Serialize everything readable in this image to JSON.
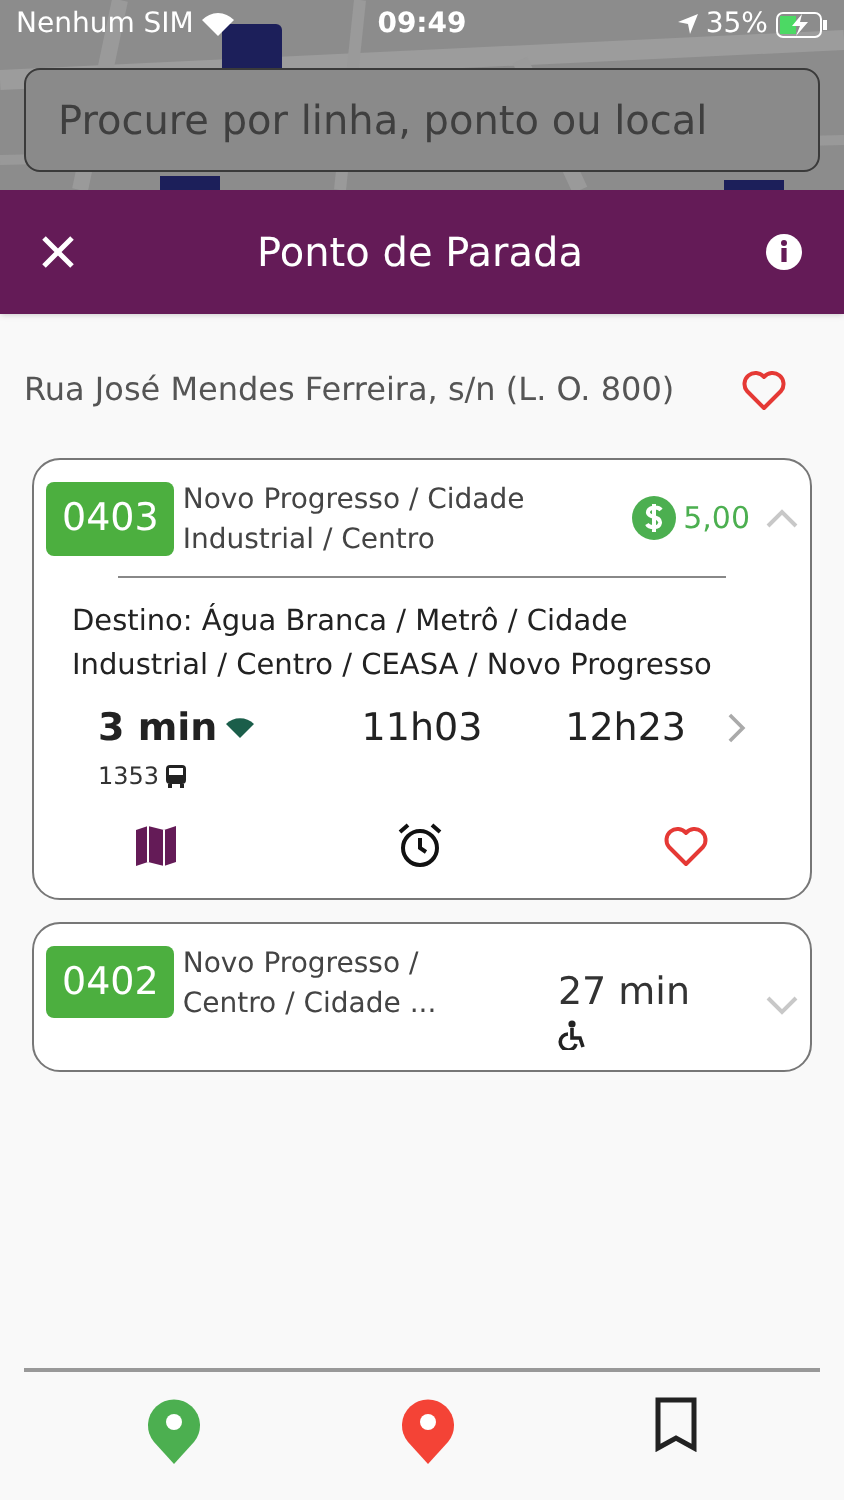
{
  "status_bar": {
    "carrier": "Nenhum SIM",
    "time": "09:49",
    "battery": "35%"
  },
  "search": {
    "placeholder": "Procure por linha, ponto ou local"
  },
  "header": {
    "title": "Ponto de Parada"
  },
  "stop": {
    "address": "Rua José Mendes Ferreira, s/n (L. O. 800)",
    "favorite": false
  },
  "lines": [
    {
      "code": "0403",
      "name": "Novo Progresso / Cidade Industrial / Centro",
      "expanded": true,
      "fare": "5,00",
      "destination": "Destino: Água Branca / Metrô / Cidade Industrial / Centro / CEASA / Novo Progresso",
      "eta": "3 min",
      "realtime": true,
      "vehicle": "1353",
      "times": [
        "11h03",
        "12h23"
      ],
      "favorite": false
    },
    {
      "code": "0402",
      "name": "Novo Progresso / Centro / Cidade ...",
      "expanded": false,
      "eta": "27 min",
      "accessible": true
    }
  ],
  "bottom_nav": [
    {
      "kind": "green-pin"
    },
    {
      "kind": "red-pin"
    },
    {
      "kind": "bookmark"
    }
  ]
}
